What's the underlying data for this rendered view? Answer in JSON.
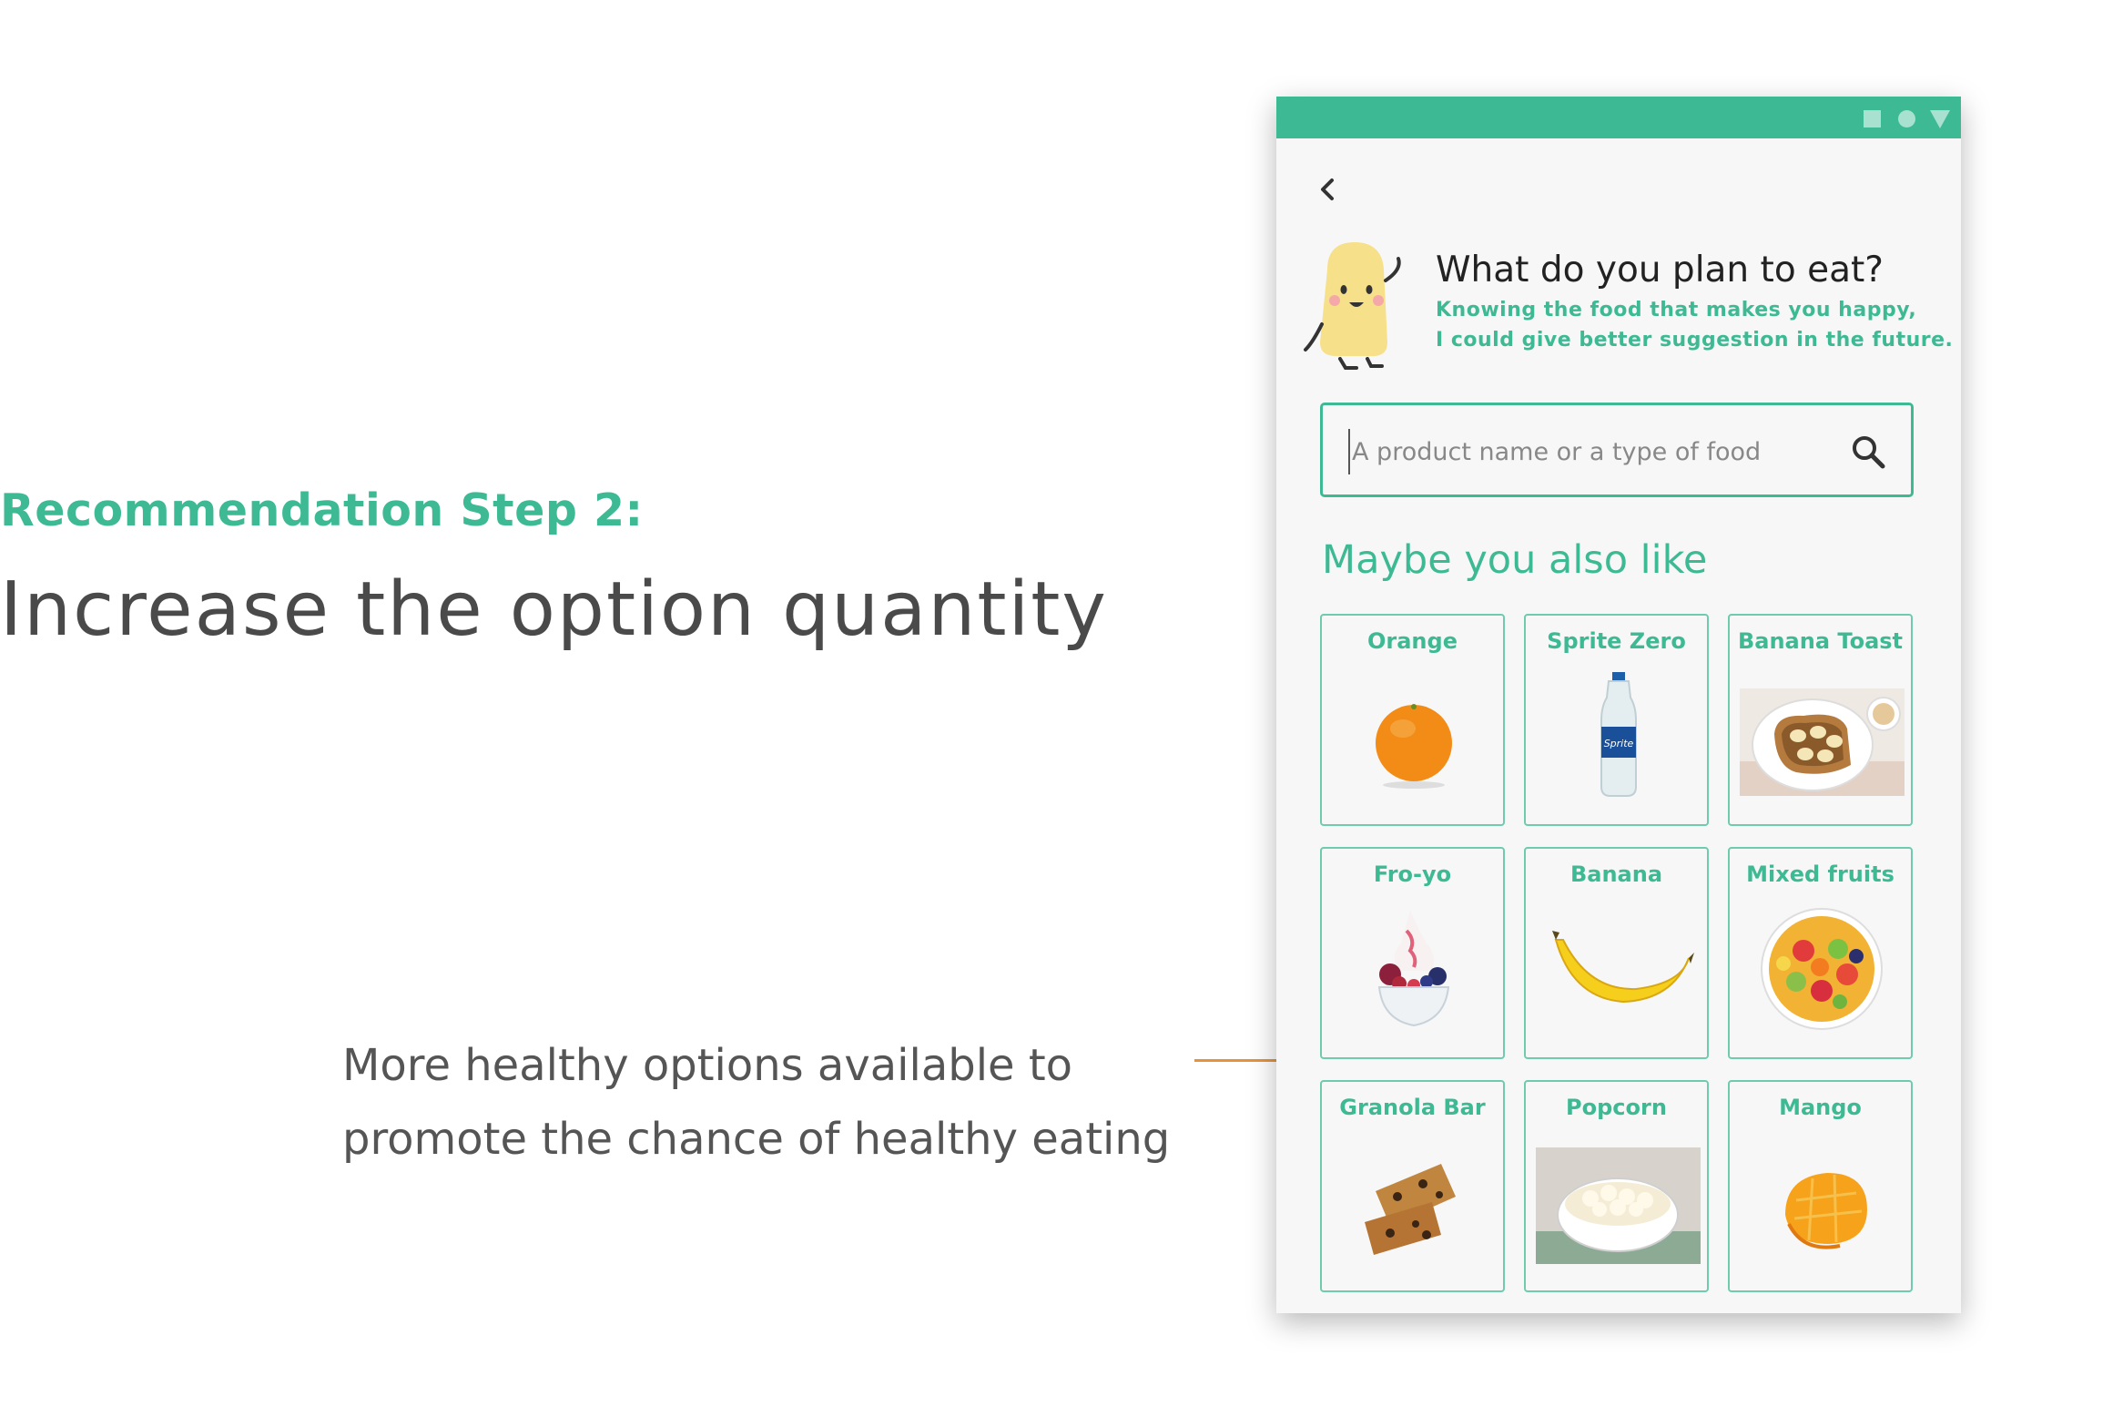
{
  "heading": {
    "step_label": "Recommendation Step 2:",
    "headline": "Increase the option quantity"
  },
  "note": {
    "line1": "More healthy options available to",
    "line2": "promote the chance of healthy eating"
  },
  "colors": {
    "accent": "#3dba93",
    "connector": "#e8913a",
    "text_dark": "#4a4a4a"
  },
  "app": {
    "question_title": "What do you plan to eat?",
    "question_sub_line1": "Knowing the food that makes you happy,",
    "question_sub_line2": "I could give better suggestion in the future.",
    "search_placeholder": "A product name or a type of food",
    "section_title": "Maybe you also like",
    "foods": [
      {
        "label": "Orange",
        "icon": "orange-image"
      },
      {
        "label": "Sprite Zero",
        "icon": "sprite-zero-bottle-image"
      },
      {
        "label": "Banana Toast",
        "icon": "banana-toast-image"
      },
      {
        "label": "Fro-yo",
        "icon": "frozen-yogurt-image"
      },
      {
        "label": "Banana",
        "icon": "banana-image"
      },
      {
        "label": "Mixed fruits",
        "icon": "mixed-fruits-image"
      },
      {
        "label": "Granola Bar",
        "icon": "granola-bar-image"
      },
      {
        "label": "Popcorn",
        "icon": "popcorn-image"
      },
      {
        "label": "Mango",
        "icon": "mango-image"
      }
    ]
  }
}
